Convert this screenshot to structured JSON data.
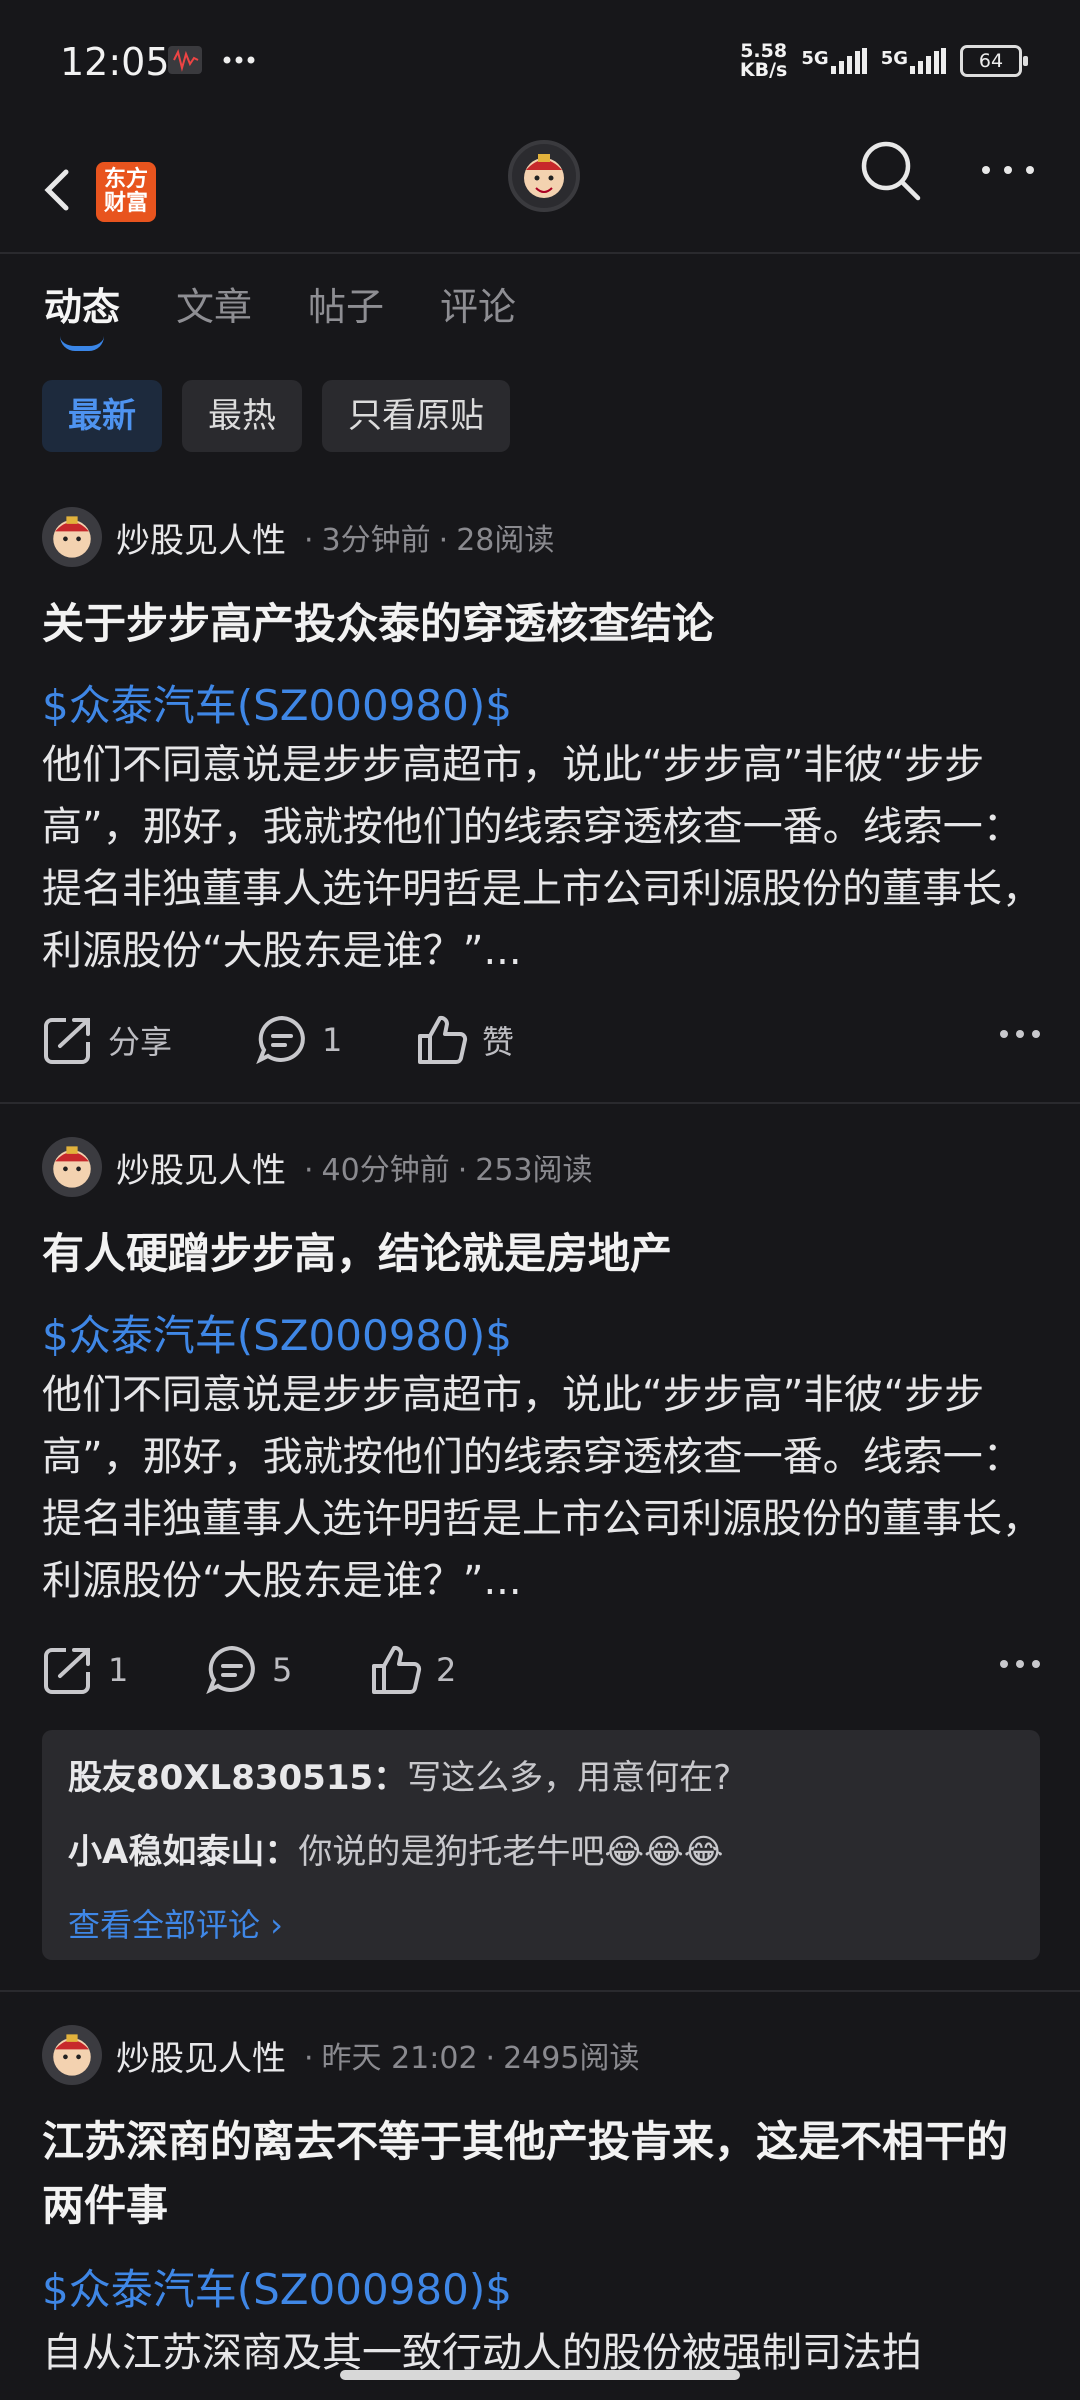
{
  "status": {
    "time": "12:05",
    "netspeed_value": "5.58",
    "netspeed_unit": "KB/s",
    "network1": "5G",
    "network2": "5G",
    "battery": "64"
  },
  "nav": {
    "logo_line1": "东方",
    "logo_line2": "财富",
    "logo_color": "#e8541e"
  },
  "tabs": [
    {
      "label": "动态"
    },
    {
      "label": "文章"
    },
    {
      "label": "帖子"
    },
    {
      "label": "评论"
    }
  ],
  "filters": [
    {
      "label": "最新"
    },
    {
      "label": "最热"
    },
    {
      "label": "只看原贴"
    }
  ],
  "posts": [
    {
      "author": "炒股见人性",
      "time": "3分钟前",
      "reads": "28阅读",
      "title": "关于步步高产投众泰的穿透核查结论",
      "stock": "$众泰汽车(SZ000980)$",
      "body": "他们不同意说是步步高超市，说此“步步高”非彼“步步高”，那好，我就按他们的线索穿透核查一番。线索一：提名非独董事人选许明哲是上市公司利源股份的董事长，利源股份“大股东是谁？”...",
      "share": "分享",
      "comments": "1",
      "likes": "赞"
    },
    {
      "author": "炒股见人性",
      "time": "40分钟前",
      "reads": "253阅读",
      "title": "有人硬蹭步步高，结论就是房地产",
      "stock": "$众泰汽车(SZ000980)$",
      "body": "他们不同意说是步步高超市，说此“步步高”非彼“步步高”，那好，我就按他们的线索穿透核查一番。线索一：提名非独董事人选许明哲是上市公司利源股份的董事长，利源股份“大股东是谁？”...",
      "share": "1",
      "comments": "5",
      "likes": "2",
      "comment_preview": [
        {
          "name": "股友80XL830515：",
          "text": "写这么多，用意何在?"
        },
        {
          "name": "小A稳如泰山：",
          "text": "你说的是狗托老牛吧😂😂😂"
        }
      ],
      "view_all": "查看全部评论 ›"
    },
    {
      "author": "炒股见人性",
      "time": "昨天 21:02",
      "reads": "2495阅读",
      "title": "江苏深商的离去不等于其他产投肯来，这是不相干的两件事",
      "stock": "$众泰汽车(SZ000980)$",
      "body": "自从江苏深商及其一致行动人的股份被强制司法拍"
    }
  ]
}
